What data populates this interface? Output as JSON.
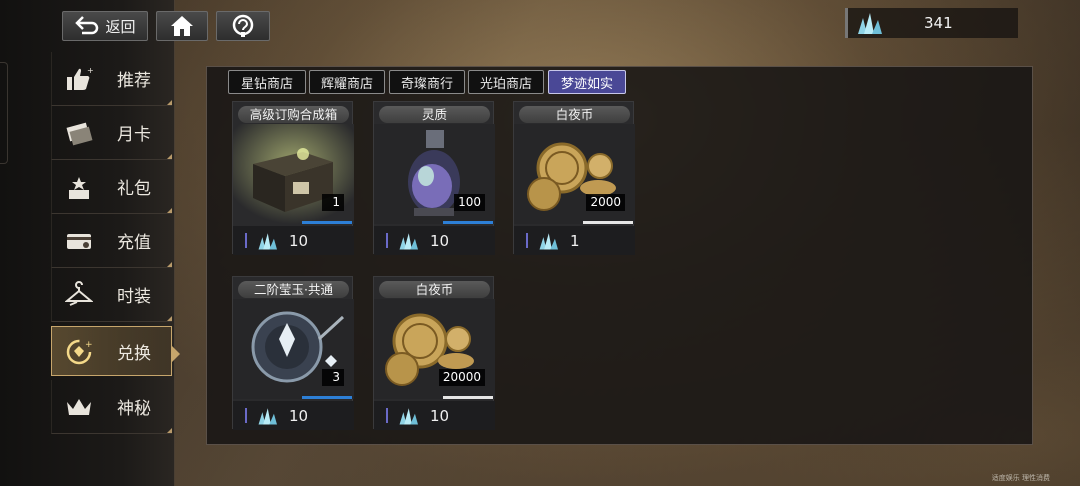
{
  "header": {
    "back_label": "返回",
    "home_icon": "home-icon",
    "help_icon": "help-icon",
    "currency": {
      "icon": "crystal-icon",
      "value": "341"
    }
  },
  "sidebar": {
    "items": [
      {
        "label": "推荐",
        "icon": "thumbs-up-icon",
        "active": false
      },
      {
        "label": "月卡",
        "icon": "card-icon",
        "active": false
      },
      {
        "label": "礼包",
        "icon": "gift-box-icon",
        "active": false
      },
      {
        "label": "充值",
        "icon": "wallet-icon",
        "active": false
      },
      {
        "label": "时装",
        "icon": "hanger-icon",
        "active": false
      },
      {
        "label": "兑换",
        "icon": "exchange-icon",
        "active": true
      },
      {
        "label": "神秘",
        "icon": "crown-icon",
        "active": false
      }
    ]
  },
  "tabs": [
    {
      "label": "星钻商店",
      "active": false
    },
    {
      "label": "辉耀商店",
      "active": false
    },
    {
      "label": "奇璨商行",
      "active": false
    },
    {
      "label": "光珀商店",
      "active": false
    },
    {
      "label": "梦迹如实",
      "active": true
    }
  ],
  "items": [
    {
      "name": "高级订购合成箱",
      "quantity": "1",
      "price": "10",
      "art": "chest-icon"
    },
    {
      "name": "灵质",
      "quantity": "100",
      "price": "10",
      "art": "lantern-icon"
    },
    {
      "name": "白夜币",
      "quantity": "2000",
      "price": "1",
      "art": "coins-icon"
    },
    {
      "name": "二阶莹玉·共通",
      "quantity": "3",
      "price": "10",
      "art": "jade-icon"
    },
    {
      "name": "白夜币",
      "quantity": "20000",
      "price": "10",
      "art": "coins-icon"
    }
  ],
  "footer_note": "适度娱乐 理性消费",
  "colors": {
    "accent_tab": "#4a4896",
    "active_nav_border": "#c7a66c",
    "qty_bar": "#2d7fd6"
  }
}
